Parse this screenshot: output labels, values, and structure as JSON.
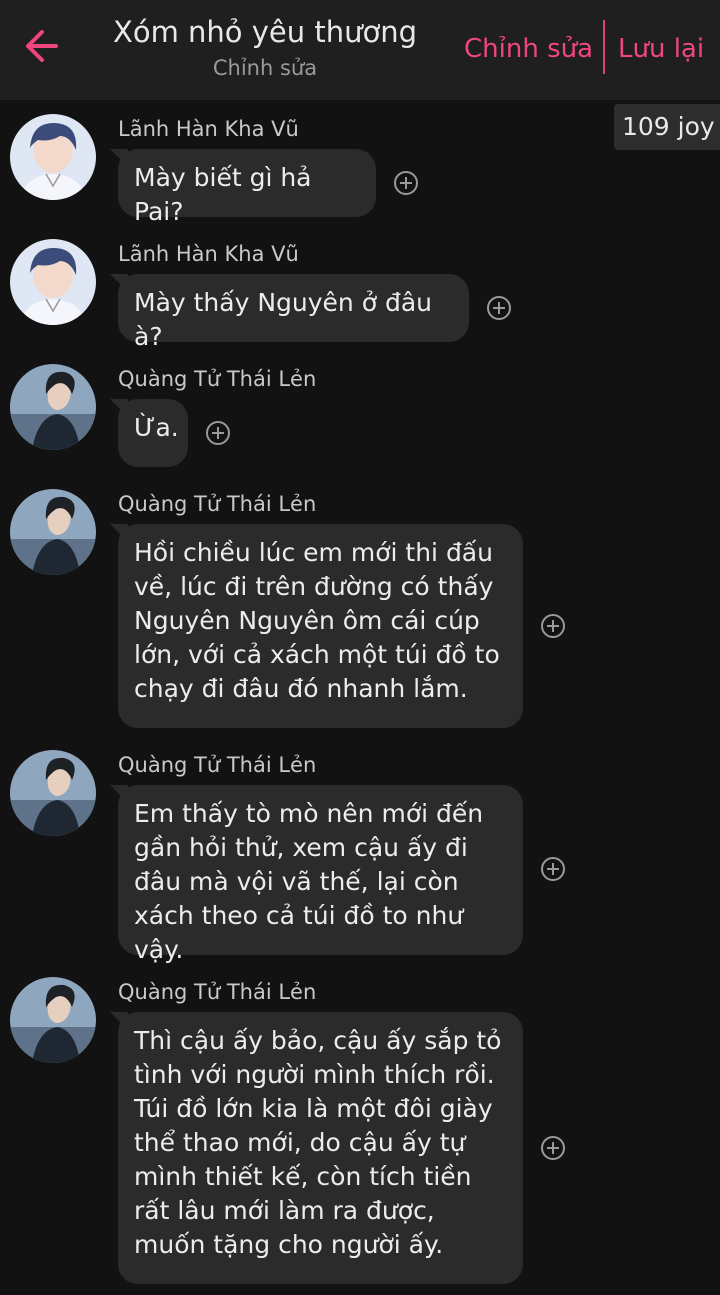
{
  "header": {
    "title": "Xóm nhỏ yêu thương",
    "subtitle": "Chỉnh sửa",
    "edit_label": "Chỉnh sửa",
    "save_label": "Lưu lại",
    "accent_color": "#f0467f",
    "back_icon": "arrow-left-icon"
  },
  "joy_badge": "109 joy",
  "messages": [
    {
      "sender": "Lãnh Hàn Kha Vũ",
      "avatar": "avatar-khavu",
      "text": "Mày biết gì hả Pai?"
    },
    {
      "sender": "Lãnh Hàn Kha Vũ",
      "avatar": "avatar-khavu",
      "text": "Mày thấy Nguyên ở đâu à?"
    },
    {
      "sender": "Quàng Tử Thái Lẻn",
      "avatar": "avatar-thailen",
      "text": "Ừa."
    },
    {
      "sender": "Quàng Tử Thái Lẻn",
      "avatar": "avatar-thailen",
      "text": "Hồi chiều lúc em mới thi đấu về, lúc đi trên đường có thấy Nguyên Nguyên ôm cái cúp lớn, với cả xách một túi đồ to chạy đi đâu đó nhanh lắm."
    },
    {
      "sender": "Quàng Tử Thái Lẻn",
      "avatar": "avatar-thailen",
      "text": "Em thấy tò mò nên mới đến gần hỏi thử, xem cậu ấy đi đâu mà vội vã thế, lại còn xách theo cả túi đồ to như vậy."
    },
    {
      "sender": "Quàng Tử Thái Lẻn",
      "avatar": "avatar-thailen",
      "text": "Thì cậu ấy bảo, cậu ấy sắp tỏ tình với người mình thích rồi. Túi đồ lớn kia là một đôi giày thể thao mới, do cậu ấy tự mình thiết kế, còn tích tiền rất lâu mới làm ra được, muốn tặng cho người ấy."
    }
  ]
}
